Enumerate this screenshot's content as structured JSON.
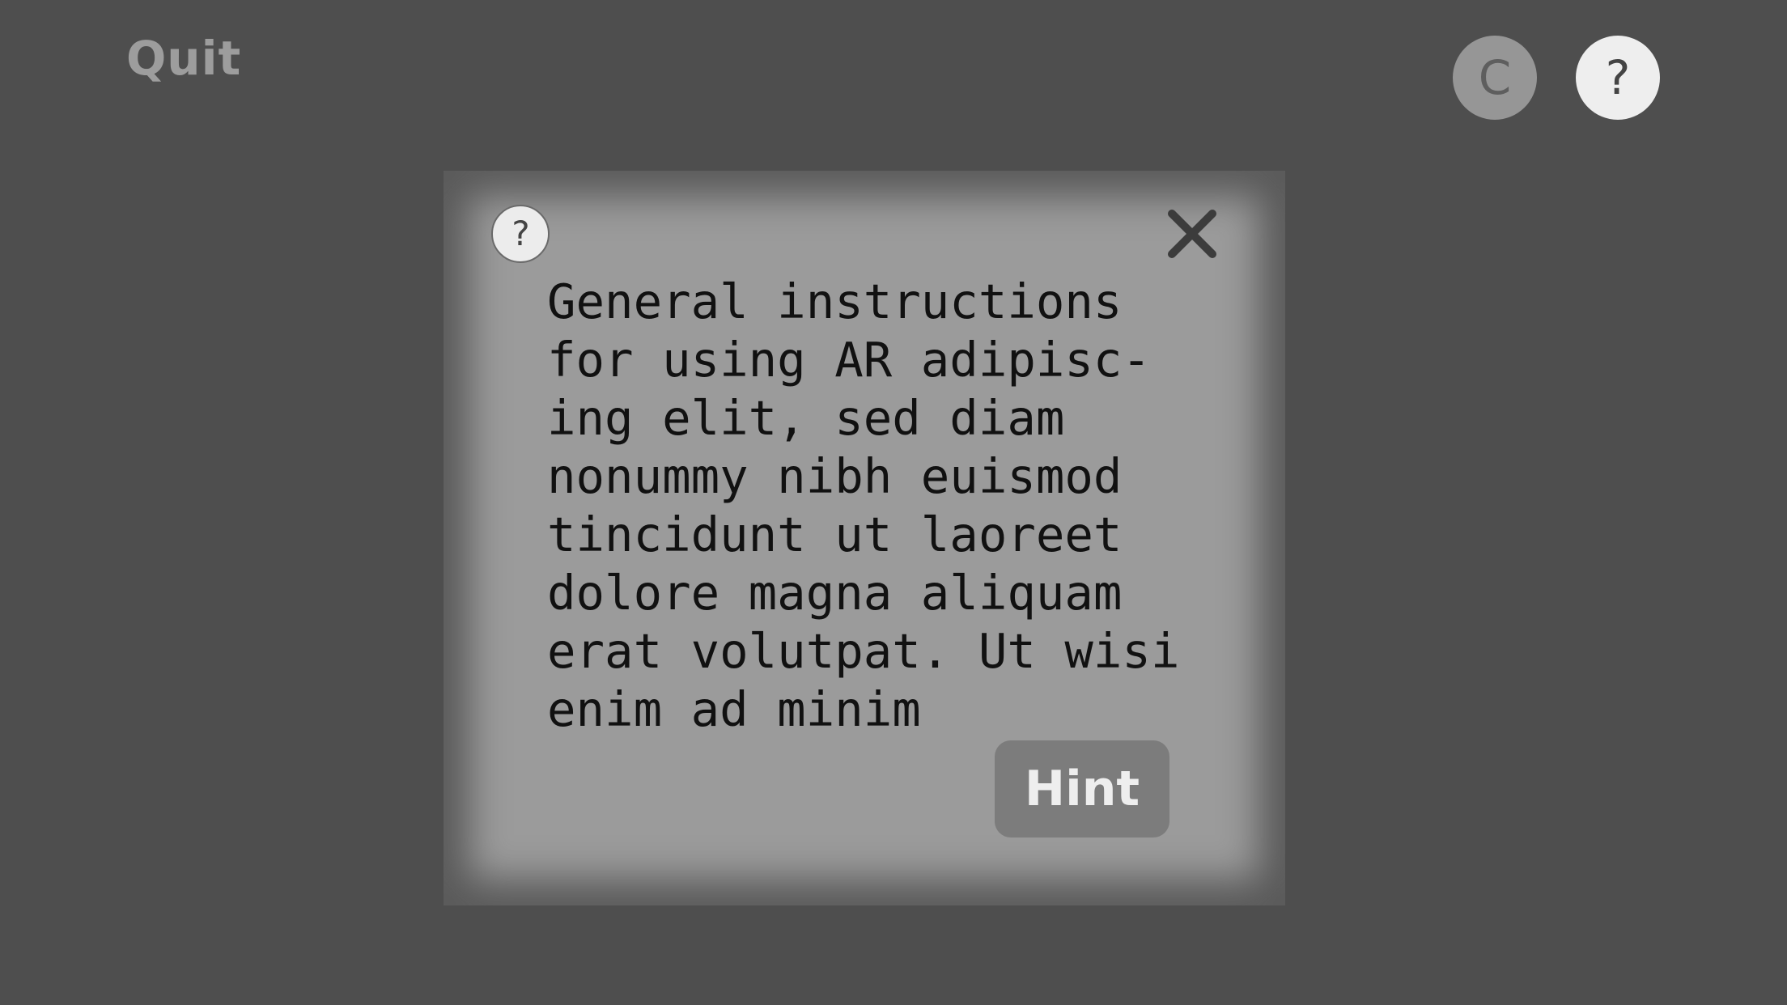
{
  "top_bar": {
    "quit_label": "Quit",
    "reset_label": "C",
    "help_label": "?"
  },
  "dialog": {
    "help_label": "?",
    "close_icon": "close-x-icon",
    "text_lines": [
      "General instructions",
      "for using AR adipisc-",
      "ing elit, sed diam",
      "nonummy nibh euismod",
      "tincidunt ut laoreet",
      "dolore magna aliquam",
      "erat volutpat. Ut wisi",
      "enim ad minim"
    ],
    "hint_label": "Hint"
  },
  "colors": {
    "background": "#4e4e4e",
    "dialog": "#9b9b9b",
    "hint_button": "#7c7c7c"
  }
}
